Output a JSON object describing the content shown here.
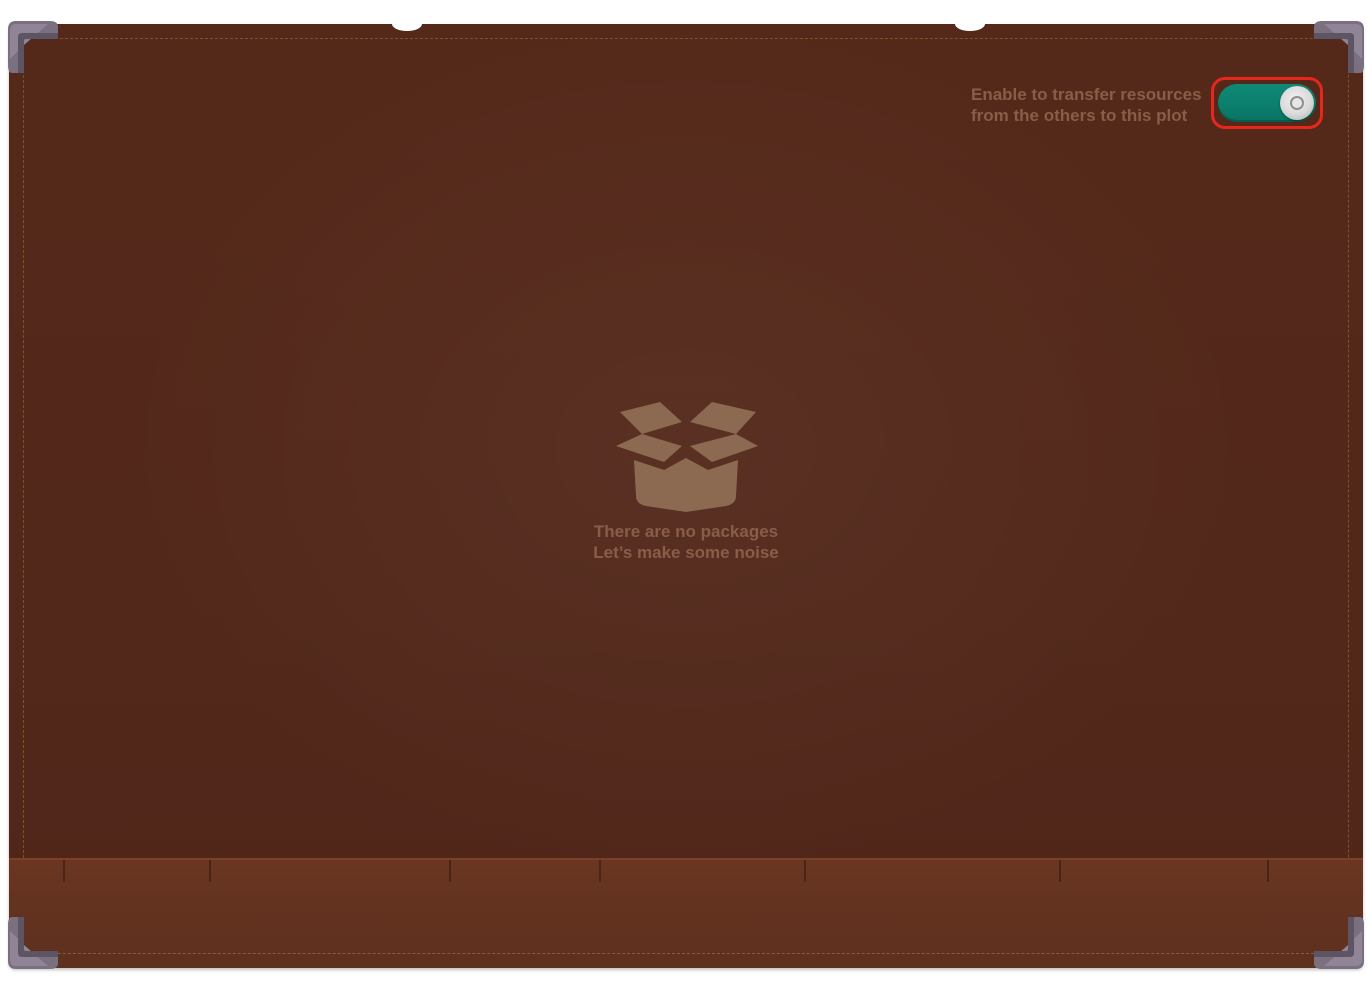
{
  "transfer_toggle": {
    "label_line1": "Enable to transfer resources",
    "label_line2": "from the others to this plot",
    "state": "on",
    "track_color": "#0b7e6c",
    "highlight_color": "#e8271c"
  },
  "empty_state": {
    "icon": "open-box-icon",
    "line1": "There are no packages",
    "line2": "Let’s make some noise"
  },
  "colors": {
    "panel": "#52281a",
    "shelf": "#643320",
    "muted_text": "#8a5d48",
    "icon": "#8b6a51"
  }
}
